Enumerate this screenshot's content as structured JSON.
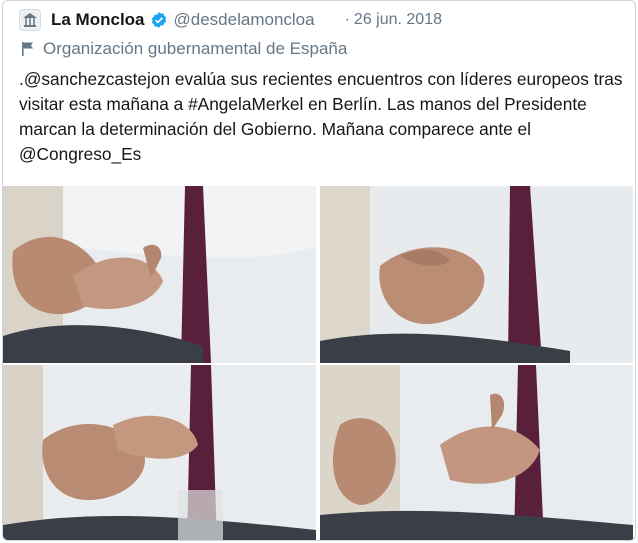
{
  "account": {
    "name": "La Moncloa",
    "handle": "@desdelamoncloa",
    "date": "26 jun. 2018",
    "dot": "·",
    "label": "Organización gubernamental de España",
    "avatar_icon": "government-building-icon",
    "verified_icon": "verified-badge-icon",
    "label_icon": "flag-icon"
  },
  "tweet": {
    "text_parts": [
      ".",
      "@sanchezcastejon",
      " evalúa sus recientes encuentros con líderes europeos tras visitar esta mañana a ",
      "#AngelaMerkel",
      " en Berlín. Las manos del Presidente marcan la determinación del Gobierno. Mañana comparece ante el ",
      "@Congreso_Es"
    ]
  },
  "media": {
    "photos": [
      {
        "description_icon": "photo-hands-1"
      },
      {
        "description_icon": "photo-hands-2"
      },
      {
        "description_icon": "photo-hands-3"
      },
      {
        "description_icon": "photo-hands-4"
      }
    ]
  },
  "colors": {
    "text": "#14171a",
    "secondary": "#657786",
    "verified": "#1da1f2",
    "border": "#c9d3db"
  }
}
